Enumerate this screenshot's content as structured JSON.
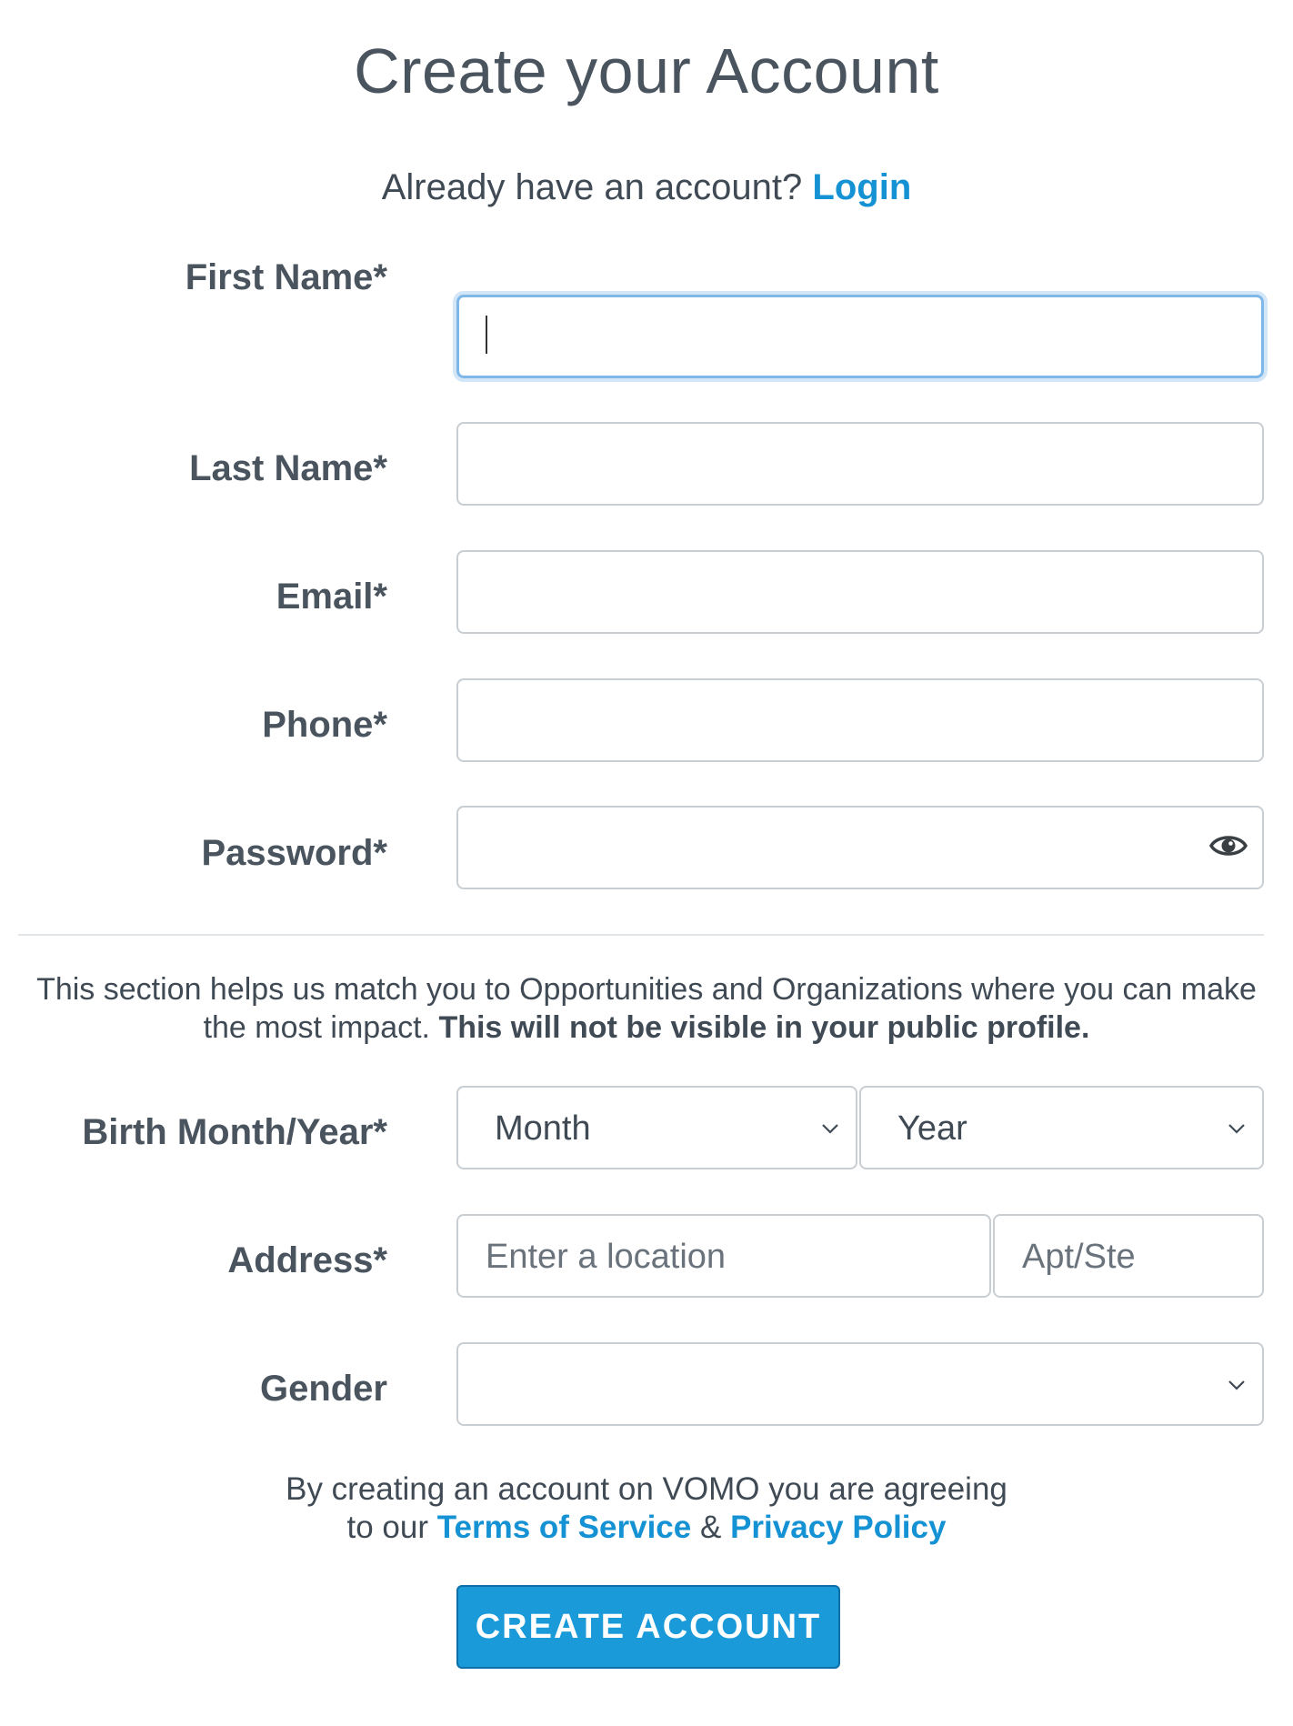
{
  "header": {
    "title": "Create your Account",
    "login_prompt": "Already have an account?",
    "login_link": "Login"
  },
  "form": {
    "first_name_label": "First Name*",
    "first_name_value": "",
    "last_name_label": "Last Name*",
    "last_name_value": "",
    "email_label": "Email*",
    "email_value": "",
    "phone_label": "Phone*",
    "phone_value": "",
    "password_label": "Password*",
    "password_value": "",
    "password_toggle_icon": "eye-icon"
  },
  "private_section": {
    "note_line1": "This section helps us match you to Opportunities and Organizations where you can make",
    "note_line2_plain": "the most impact.",
    "note_line2_bold": "This will not be visible in your public profile.",
    "birth_label": "Birth Month/Year*",
    "birth_month_selected": "Month",
    "birth_year_selected": "Year",
    "address_label": "Address*",
    "address_placeholder": "Enter a location",
    "apt_placeholder": "Apt/Ste",
    "gender_label": "Gender",
    "gender_selected": ""
  },
  "footer": {
    "terms_line1": "By creating an account on VOMO you are agreeing",
    "terms_line2_prefix": "to our",
    "terms_of_service": "Terms of Service",
    "ampersand": "&",
    "privacy_policy": "Privacy Policy",
    "submit_label": "CREATE ACCOUNT"
  },
  "colors": {
    "accent": "#1592d3",
    "button_bg": "#1a9ad9",
    "text": "#3f4a55",
    "border": "#c9ced3",
    "focus_ring": "#7fb7e8"
  }
}
